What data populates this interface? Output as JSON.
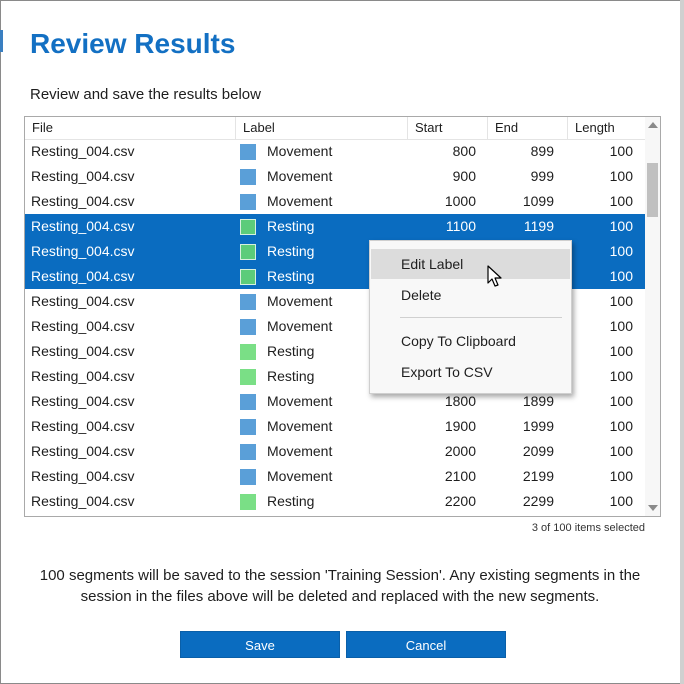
{
  "dialog": {
    "title": "Review Results",
    "subtitle": "Review and save the results below"
  },
  "table": {
    "columns": [
      "File",
      "Label",
      "Start",
      "End",
      "Length"
    ],
    "rows": [
      {
        "file": "Resting_004.csv",
        "label": "Movement",
        "start": "800",
        "end": "899",
        "length": "100",
        "selected": false
      },
      {
        "file": "Resting_004.csv",
        "label": "Movement",
        "start": "900",
        "end": "999",
        "length": "100",
        "selected": false
      },
      {
        "file": "Resting_004.csv",
        "label": "Movement",
        "start": "1000",
        "end": "1099",
        "length": "100",
        "selected": false
      },
      {
        "file": "Resting_004.csv",
        "label": "Resting",
        "start": "1100",
        "end": "1199",
        "length": "100",
        "selected": true
      },
      {
        "file": "Resting_004.csv",
        "label": "Resting",
        "start": "",
        "end": "",
        "length": "100",
        "selected": true
      },
      {
        "file": "Resting_004.csv",
        "label": "Resting",
        "start": "",
        "end": "",
        "length": "100",
        "selected": true
      },
      {
        "file": "Resting_004.csv",
        "label": "Movement",
        "start": "",
        "end": "",
        "length": "100",
        "selected": false
      },
      {
        "file": "Resting_004.csv",
        "label": "Movement",
        "start": "",
        "end": "",
        "length": "100",
        "selected": false
      },
      {
        "file": "Resting_004.csv",
        "label": "Resting",
        "start": "",
        "end": "",
        "length": "100",
        "selected": false
      },
      {
        "file": "Resting_004.csv",
        "label": "Resting",
        "start": "",
        "end": "",
        "length": "100",
        "selected": false
      },
      {
        "file": "Resting_004.csv",
        "label": "Movement",
        "start": "1800",
        "end": "1899",
        "length": "100",
        "selected": false
      },
      {
        "file": "Resting_004.csv",
        "label": "Movement",
        "start": "1900",
        "end": "1999",
        "length": "100",
        "selected": false
      },
      {
        "file": "Resting_004.csv",
        "label": "Movement",
        "start": "2000",
        "end": "2099",
        "length": "100",
        "selected": false
      },
      {
        "file": "Resting_004.csv",
        "label": "Movement",
        "start": "2100",
        "end": "2199",
        "length": "100",
        "selected": false
      },
      {
        "file": "Resting_004.csv",
        "label": "Resting",
        "start": "2200",
        "end": "2299",
        "length": "100",
        "selected": false
      }
    ],
    "selection_status": "3 of 100 items selected"
  },
  "context_menu": {
    "items": [
      "Edit Label",
      "Delete",
      "Copy To Clipboard",
      "Export To CSV"
    ],
    "hovered": "Edit Label"
  },
  "message": "100 segments will be saved to the session 'Training Session'. Any existing segments in the session in the files above will be deleted and replaced with the new segments.",
  "buttons": {
    "save": "Save",
    "cancel": "Cancel"
  },
  "colors": {
    "accent": "#0a6cc0",
    "title": "#1370c3",
    "movement": "#5a9fd8",
    "resting": "#7adf86"
  }
}
